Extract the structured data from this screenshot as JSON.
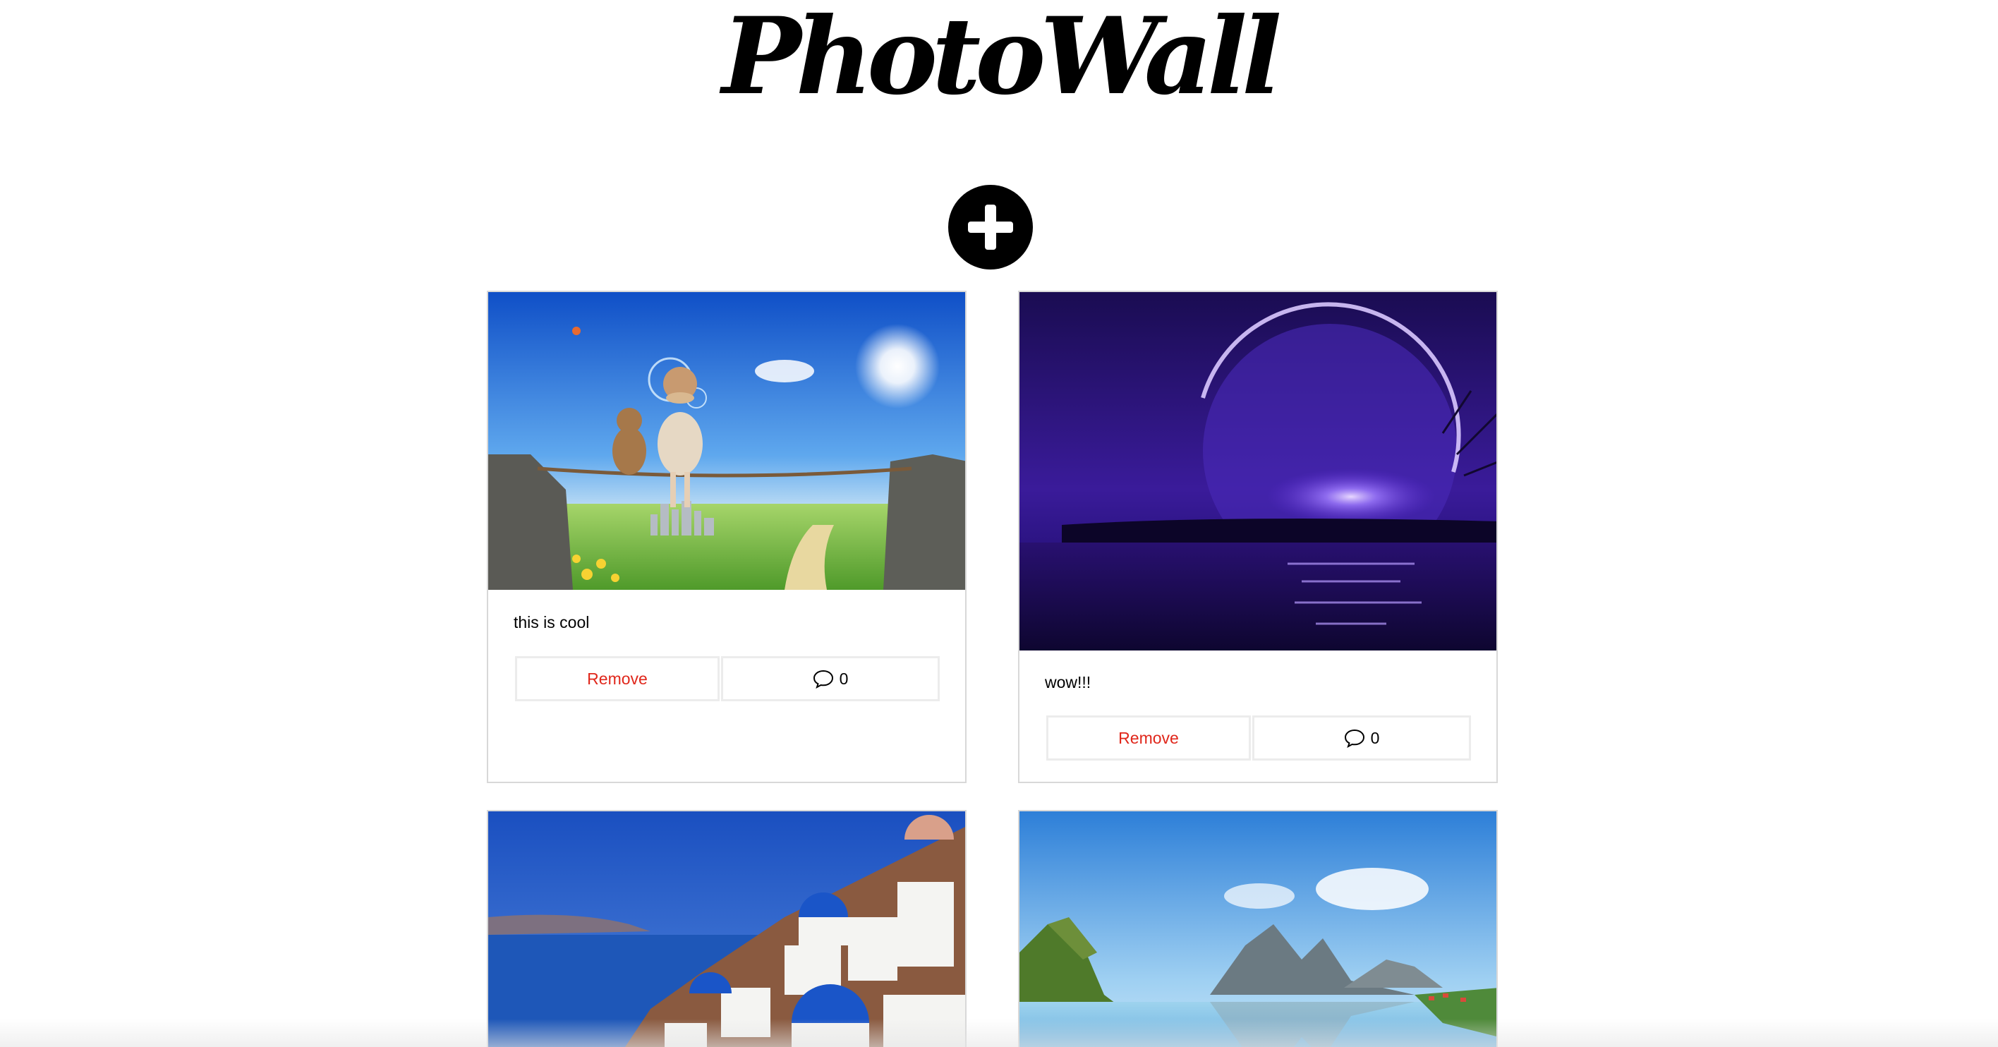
{
  "app": {
    "logo_text": "PhotoWall"
  },
  "add": {
    "icon": "plus-icon"
  },
  "posts": [
    {
      "caption": "this is cool",
      "remove_label": "Remove",
      "comment_count": "0",
      "image": "child-and-teddy-on-rope-between-cliffs"
    },
    {
      "caption": "wow!!!",
      "remove_label": "Remove",
      "comment_count": "0",
      "image": "purple-moon-over-water"
    },
    {
      "caption": "",
      "remove_label": "",
      "comment_count": "",
      "image": "santorini-blue-domes"
    },
    {
      "caption": "",
      "remove_label": "",
      "comment_count": "",
      "image": "mountain-lake-village"
    }
  ],
  "colors": {
    "remove_text": "#e0271b",
    "card_border": "#d8d8d8",
    "button_border": "#ececec"
  }
}
